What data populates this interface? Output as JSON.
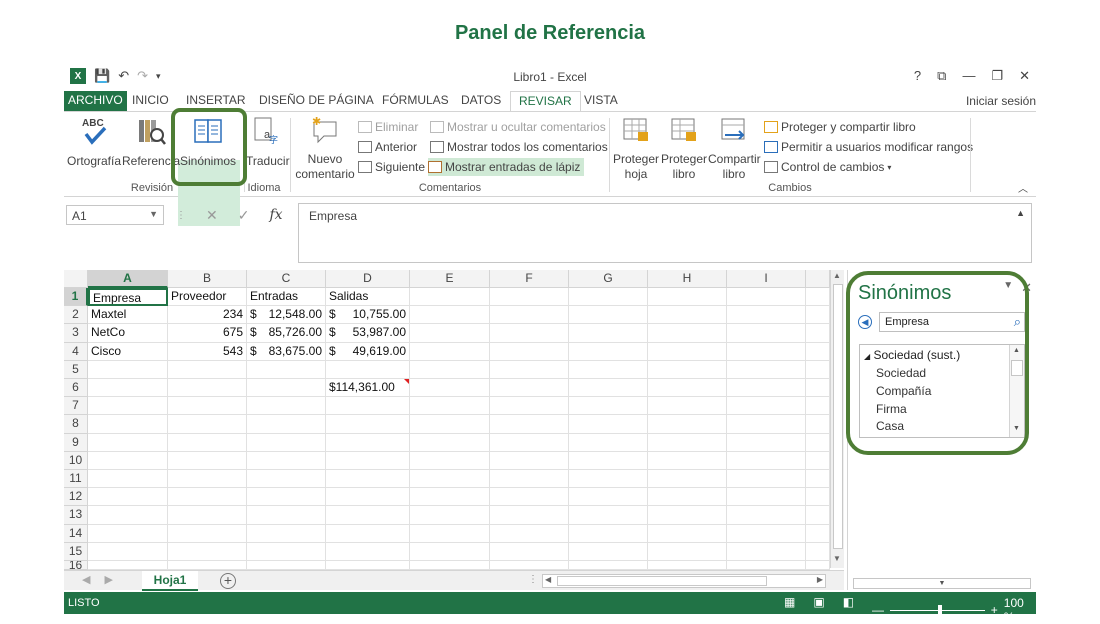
{
  "heading": "Panel de Referencia",
  "window": {
    "title": "Libro1 - Excel",
    "controls": [
      "?",
      "⧉",
      "—",
      "❐",
      "✕"
    ],
    "signin": "Iniciar sesión"
  },
  "tabs": [
    "ARCHIVO",
    "INICIO",
    "INSERTAR",
    "DISEÑO DE PÁGINA",
    "FÓRMULAS",
    "DATOS",
    "REVISAR",
    "VISTA"
  ],
  "active_tab": "REVISAR",
  "ribbon": {
    "revision": {
      "label": "Revisión",
      "ortografia": "Ortografía",
      "referencia": "Referencia",
      "sinonimos": "Sinónimos"
    },
    "idioma": {
      "label": "Idioma",
      "traducir": "Traducir"
    },
    "comentarios": {
      "label": "Comentarios",
      "nuevo_1": "Nuevo",
      "nuevo_2": "comentario",
      "eliminar": "Eliminar",
      "anterior": "Anterior",
      "siguiente": "Siguiente",
      "mostrar_ocultar": "Mostrar u ocultar comentarios",
      "mostrar_todos": "Mostrar todos los comentarios",
      "mostrar_lapiz": "Mostrar entradas de lápiz"
    },
    "cambios": {
      "label": "Cambios",
      "proteger_hoja_1": "Proteger",
      "proteger_hoja_2": "hoja",
      "proteger_libro_1": "Proteger",
      "proteger_libro_2": "libro",
      "compartir_1": "Compartir",
      "compartir_2": "libro",
      "proteger_compartir": "Proteger y compartir libro",
      "permitir": "Permitir a usuarios modificar rangos",
      "control": "Control de cambios"
    }
  },
  "formula_bar": {
    "name_box": "A1",
    "fx": "fx",
    "content": "Empresa"
  },
  "grid": {
    "columns": [
      "A",
      "B",
      "C",
      "D",
      "E",
      "F",
      "G",
      "H",
      "I"
    ],
    "rows": [
      "1",
      "2",
      "3",
      "4",
      "5",
      "6",
      "7",
      "8",
      "9",
      "10",
      "11",
      "12",
      "13",
      "14",
      "15",
      "16"
    ],
    "headers": [
      "Empresa",
      "Proveedor",
      "Entradas",
      "Salidas"
    ],
    "data": [
      {
        "empresa": "Maxtel",
        "proveedor": "234",
        "entradas": "12,548.00",
        "salidas": "10,755.00"
      },
      {
        "empresa": "NetCo",
        "proveedor": "675",
        "entradas": "85,726.00",
        "salidas": "53,987.00"
      },
      {
        "empresa": "Cisco",
        "proveedor": "543",
        "entradas": "83,675.00",
        "salidas": "49,619.00"
      }
    ],
    "currency": "$",
    "total": "$114,361.00"
  },
  "sheets": {
    "active": "Hoja1",
    "add": "+"
  },
  "status": {
    "text": "LISTO",
    "zoom": "100 %"
  },
  "pane": {
    "title": "Sinónimos",
    "search_value": "Empresa",
    "group": "Sociedad (sust.)",
    "items": [
      "Sociedad",
      "Compañía",
      "Firma",
      "Casa"
    ]
  },
  "colors": {
    "excel_green": "#217346",
    "highlight_ring": "#4e7d35",
    "comment_marker": "#e02020"
  }
}
